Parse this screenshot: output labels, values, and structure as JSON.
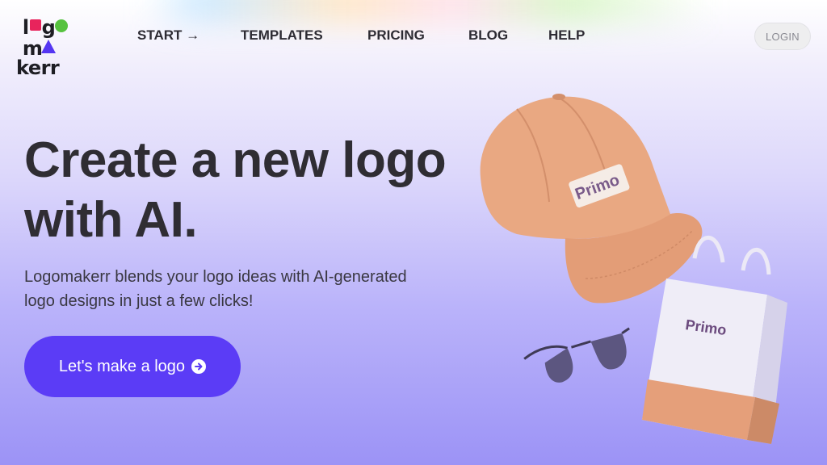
{
  "brand": {
    "line1": "logo",
    "line2": "makerr"
  },
  "nav": {
    "items": [
      {
        "label": "START →"
      },
      {
        "label": "TEMPLATES"
      },
      {
        "label": "PRICING"
      },
      {
        "label": "BLOG"
      },
      {
        "label": "HELP"
      }
    ],
    "login_label": "LOGIN"
  },
  "hero": {
    "title_line1": "Create a new logo",
    "title_line2": "with AI.",
    "subtitle_line1": "Logomakerr blends your logo ideas with AI-generated",
    "subtitle_line2": "logo designs in just a few clicks!",
    "cta_label": "Let's make a logo",
    "cta_icon": "➔"
  },
  "art": {
    "cap_brand": "Primo",
    "bag_brand": "Primo"
  },
  "colors": {
    "accent": "#5b3cf6",
    "logo_pink": "#e8245c",
    "logo_green": "#56c23f",
    "cap": "#e6a77e"
  }
}
